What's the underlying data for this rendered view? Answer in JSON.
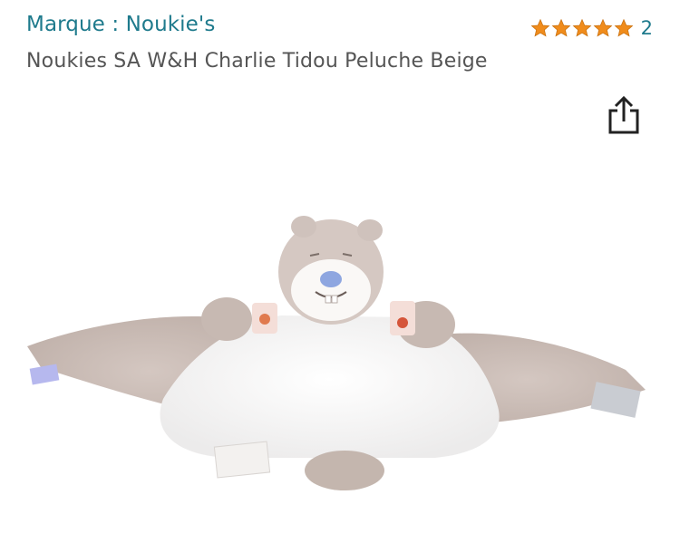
{
  "header": {
    "brand": "Marque : Noukie's",
    "rating": {
      "stars": 5,
      "max": 5,
      "count": "2",
      "star_color": "#f08c1c"
    },
    "title": "Noukies SA W&H Charlie Tidou Peluche Beige"
  },
  "actions": {
    "share_icon": "share-icon"
  },
  "colors": {
    "link": "#1e7a8c",
    "title": "#555555",
    "plush_beige": "#c9bcb6",
    "plush_white": "#ffffff"
  }
}
